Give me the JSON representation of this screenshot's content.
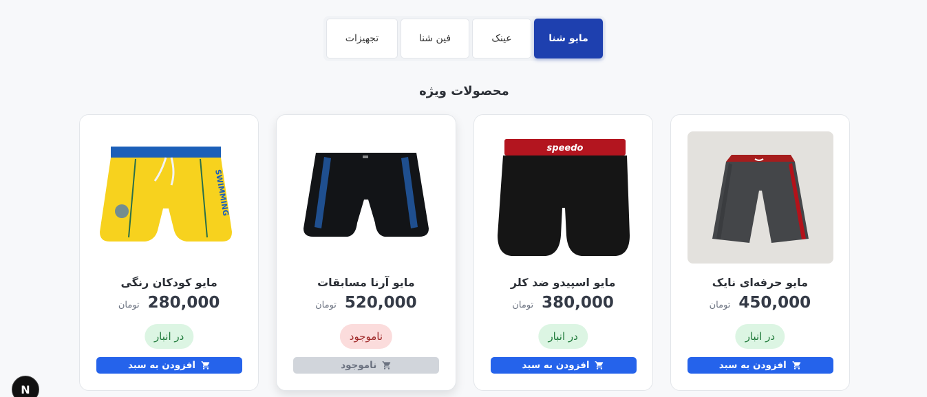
{
  "tabs": [
    {
      "label": "مایو شنا",
      "active": true
    },
    {
      "label": "عینک",
      "active": false
    },
    {
      "label": "فین شنا",
      "active": false
    },
    {
      "label": "تجهیزات",
      "active": false
    }
  ],
  "section_title": "محصولات ویژه",
  "products": [
    {
      "name": "مایو حرفه‌ای نایک",
      "price": "450,000",
      "unit": "تومان",
      "stock": "در انبار",
      "button": "افزودن به سبد",
      "icon": "shorts-gray-red-icon"
    },
    {
      "name": "مایو اسپیدو ضد کلر",
      "price": "380,000",
      "unit": "تومان",
      "stock": "در انبار",
      "button": "افزودن به سبد",
      "icon": "shorts-black-speedo-icon",
      "brand_text": "speedo"
    },
    {
      "name": "مایو آرنا مسابقات",
      "price": "520,000",
      "unit": "تومان",
      "stock": "ناموجود",
      "button": "ناموجود",
      "icon": "trunks-black-blue-icon"
    },
    {
      "name": "مایو کودکان رنگی",
      "price": "280,000",
      "unit": "تومان",
      "stock": "در انبار",
      "button": "افزودن به سبد",
      "icon": "shorts-yellow-kids-icon",
      "brand_text": "SWIMMING"
    }
  ],
  "logo": {
    "letter": "N"
  },
  "colors": {
    "primary": "#1e40af",
    "button": "#2563eb",
    "in_stock_bg": "#dcf5e3",
    "out_stock_bg": "#fbdcdc"
  }
}
